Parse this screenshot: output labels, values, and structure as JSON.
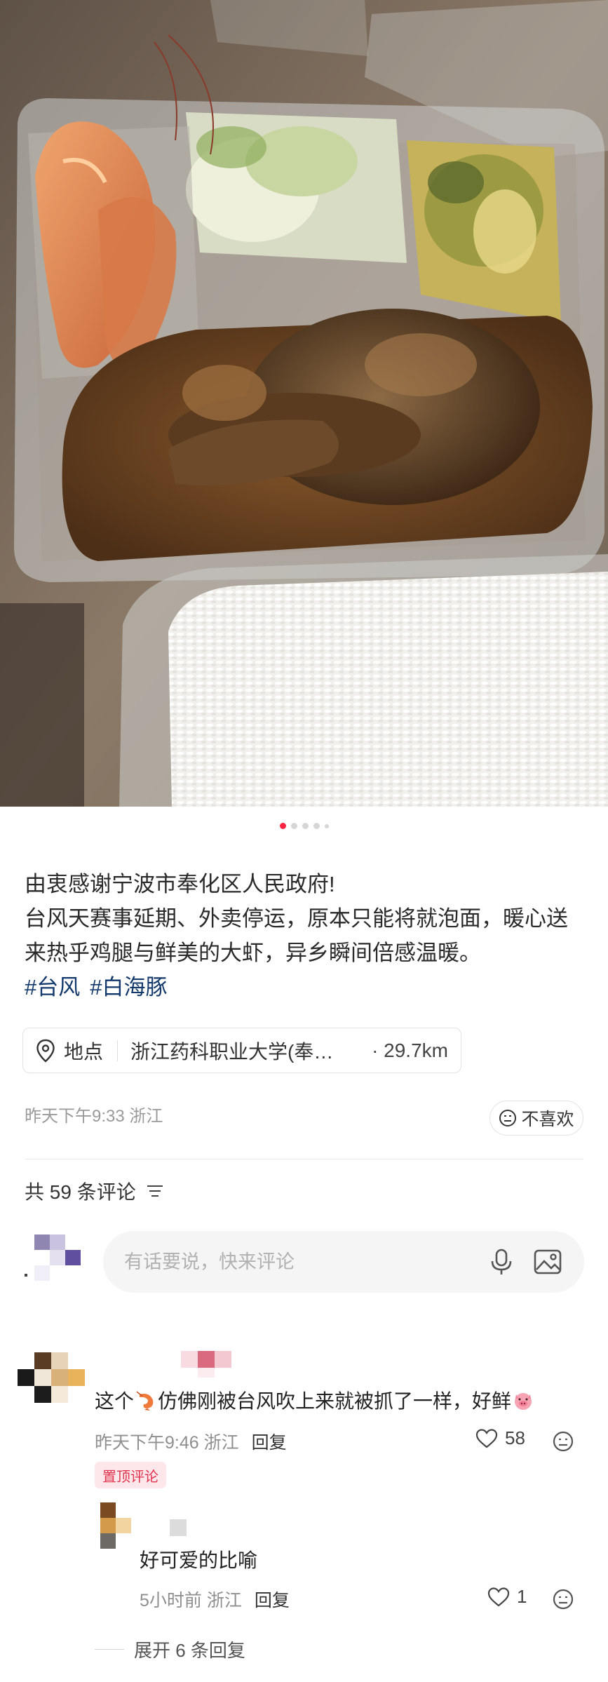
{
  "photo": {
    "alt_icon": "food-photo",
    "carousel": {
      "total": 5,
      "active_index": 0
    }
  },
  "post": {
    "line1": "由衷感谢宁波市奉化区人民政府!",
    "line2": "台风天赛事延期、外卖停运，原本只能将就泡面，暖心送来热乎鸡腿与鲜美的大虾，异乡瞬间倍感温暖。",
    "tags": [
      "#台风",
      "#白海豚"
    ]
  },
  "location": {
    "label": "地点",
    "place": "浙江药科职业大学(奉…",
    "distance": "· 29.7km",
    "icon": "location-pin-icon"
  },
  "meta": {
    "time_place": "昨天下午9:33 浙江",
    "dislike_label": "不喜欢"
  },
  "comments_header": {
    "count_label": "共 59 条评论",
    "sort_icon": "sort-icon"
  },
  "comment_input": {
    "placeholder": "有话要说，快来评论"
  },
  "comments": [
    {
      "text_before": "这个",
      "text_middle": "仿佛刚被台风吹上来就被抓了一样，好鲜",
      "time_place": "昨天下午9:46 浙江",
      "reply_label": "回复",
      "likes": "58",
      "badge": "置顶评论",
      "emoji_1": "shrimp-emoji",
      "emoji_2": "pig-emoji"
    },
    {
      "text": "好可爱的比喻",
      "time_place": "5小时前 浙江",
      "reply_label": "回复",
      "likes": "1"
    }
  ],
  "expand": {
    "label": "展开 6 条回复"
  },
  "colors": {
    "accent": "#ff2442",
    "tag": "#13386c",
    "pinned_bg": "#fde7ea",
    "pinned_text": "#e0334e"
  }
}
